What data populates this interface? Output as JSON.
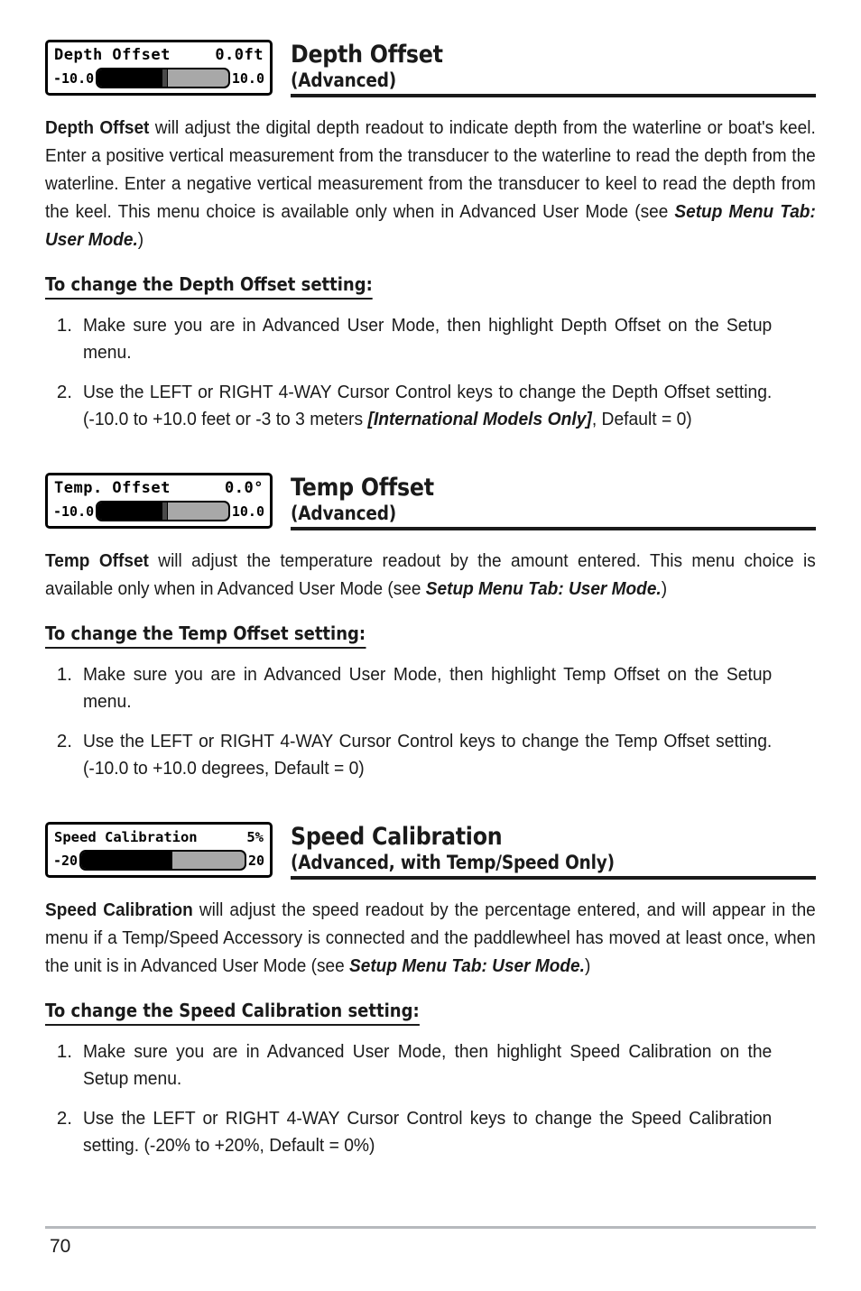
{
  "page": {
    "number": "70"
  },
  "sections": [
    {
      "id": "depth-offset",
      "widget": {
        "label": "Depth Offset",
        "value": "0.0ft",
        "min": "-10.0",
        "max": "10.0",
        "fill_percent": 50,
        "thumb_percent": 50,
        "has_thumb": true
      },
      "title": "Depth Offset",
      "subtitle": "(Advanced)",
      "paragraphs": [
        {
          "runs": [
            {
              "text": "Depth Offset",
              "style": "bold"
            },
            {
              "text": " will adjust the digital depth readout to indicate depth from the waterline or boat's keel. Enter a positive vertical measurement from the transducer to the waterline to read the depth from the waterline. Enter a negative vertical measurement from the transducer to keel to read the depth from the keel. This menu choice is available only when in Advanced User Mode (see ",
              "style": "normal"
            },
            {
              "text": "Setup Menu Tab: User Mode.",
              "style": "bold-italic"
            },
            {
              "text": ")",
              "style": "normal"
            }
          ]
        }
      ],
      "subhead": "To change the Depth Offset setting:",
      "steps": [
        {
          "num": "1.",
          "runs": [
            {
              "text": "Make sure you are in Advanced User Mode, then highlight Depth Offset on the Setup menu.",
              "style": "normal"
            }
          ]
        },
        {
          "num": "2.",
          "runs": [
            {
              "text": "Use the LEFT or RIGHT 4-WAY Cursor Control keys to change the Depth Offset setting. (-10.0 to +10.0 feet or -3 to 3 meters ",
              "style": "normal"
            },
            {
              "text": "[International Models Only]",
              "style": "bold-italic"
            },
            {
              "text": ", Default = 0)",
              "style": "normal"
            }
          ]
        }
      ]
    },
    {
      "id": "temp-offset",
      "widget": {
        "label": "Temp. Offset",
        "value": "0.0°",
        "min": "-10.0",
        "max": "10.0",
        "fill_percent": 50,
        "thumb_percent": 50,
        "has_thumb": true
      },
      "title": "Temp Offset",
      "subtitle": "(Advanced)",
      "paragraphs": [
        {
          "runs": [
            {
              "text": "Temp Offset",
              "style": "bold"
            },
            {
              "text": " will adjust the temperature readout by the amount entered. This menu choice is available only when in Advanced User Mode  (see ",
              "style": "normal"
            },
            {
              "text": "Setup Menu Tab: User Mode.",
              "style": "bold-italic"
            },
            {
              "text": ")",
              "style": "normal"
            }
          ]
        }
      ],
      "subhead": "To change the Temp Offset setting:",
      "steps": [
        {
          "num": "1.",
          "runs": [
            {
              "text": "Make sure you are in Advanced User Mode, then highlight Temp Offset on the Setup menu.",
              "style": "normal"
            }
          ]
        },
        {
          "num": "2.",
          "runs": [
            {
              "text": "Use the LEFT or RIGHT 4-WAY Cursor Control keys to change the Temp Offset setting. (-10.0 to +10.0 degrees, Default = 0)",
              "style": "normal"
            }
          ]
        }
      ]
    },
    {
      "id": "speed-calibration",
      "widget": {
        "label": "Speed Calibration",
        "value": "5%",
        "min": "-20",
        "max": "20",
        "fill_percent": 56,
        "thumb_percent": 56,
        "has_thumb": false
      },
      "title": "Speed Calibration",
      "subtitle": "(Advanced, with Temp/Speed Only)",
      "paragraphs": [
        {
          "runs": [
            {
              "text": "Speed Calibration",
              "style": "bold"
            },
            {
              "text": " will adjust the speed readout by the percentage entered, and will appear in the menu if a Temp/Speed Accessory is connected and the paddlewheel has moved at least once, when the unit is in Advanced User Mode (see ",
              "style": "normal"
            },
            {
              "text": "Setup Menu Tab: User Mode.",
              "style": "bold-italic"
            },
            {
              "text": ")",
              "style": "normal"
            }
          ]
        }
      ],
      "subhead": "To change the Speed Calibration setting:",
      "steps": [
        {
          "num": "1.",
          "runs": [
            {
              "text": "Make sure you are in Advanced User Mode, then highlight Speed Calibration on the Setup menu.",
              "style": "normal"
            }
          ]
        },
        {
          "num": "2.",
          "runs": [
            {
              "text": "Use the LEFT or RIGHT 4-WAY Cursor Control keys to change the Speed Calibration setting. (-20% to +20%, Default = 0%)",
              "style": "normal"
            }
          ]
        }
      ]
    }
  ],
  "colors": {
    "text": "#1a1a1a",
    "rule": "#1a1a1a",
    "footer_rule": "#b6b9bd",
    "lcd_bar_track": "#a8a8a8",
    "lcd_bar_fill": "#000000"
  }
}
